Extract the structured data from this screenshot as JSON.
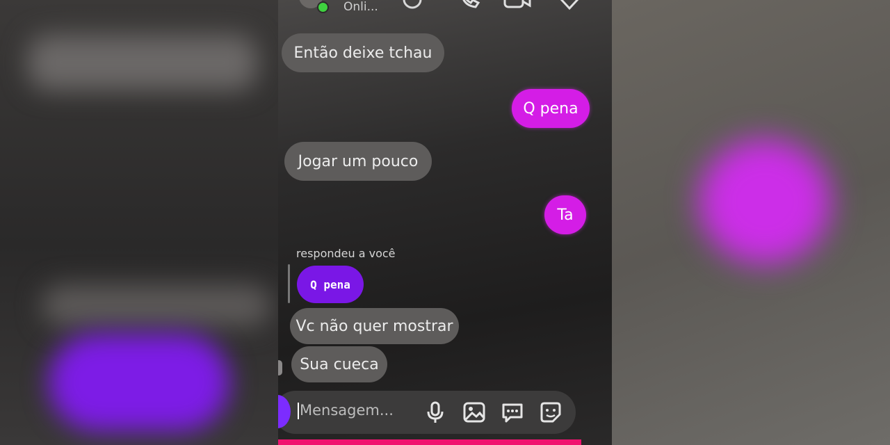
{
  "header": {
    "status": "Onli..."
  },
  "messages": {
    "m1": "Então deixe tchau",
    "m2": "Q pena",
    "m3": "Jogar um pouco",
    "m4": "Ta",
    "reply_label": "respondeu a você",
    "quoted": "Q pena",
    "m5": "Vc não quer mostrar",
    "m6": "Sua cueca"
  },
  "composer": {
    "placeholder": "Mensagem..."
  },
  "colors": {
    "sent_bubble": "#d41de6",
    "received_bubble": "#5e5c5b",
    "quoted_bubble": "#7a17e6",
    "online": "#3fd23f",
    "accent_bar": "#f0136f"
  },
  "icons": [
    "phone-icon",
    "video-icon",
    "heart-icon",
    "mic-icon",
    "image-icon",
    "chat-icon",
    "sticker-icon"
  ]
}
